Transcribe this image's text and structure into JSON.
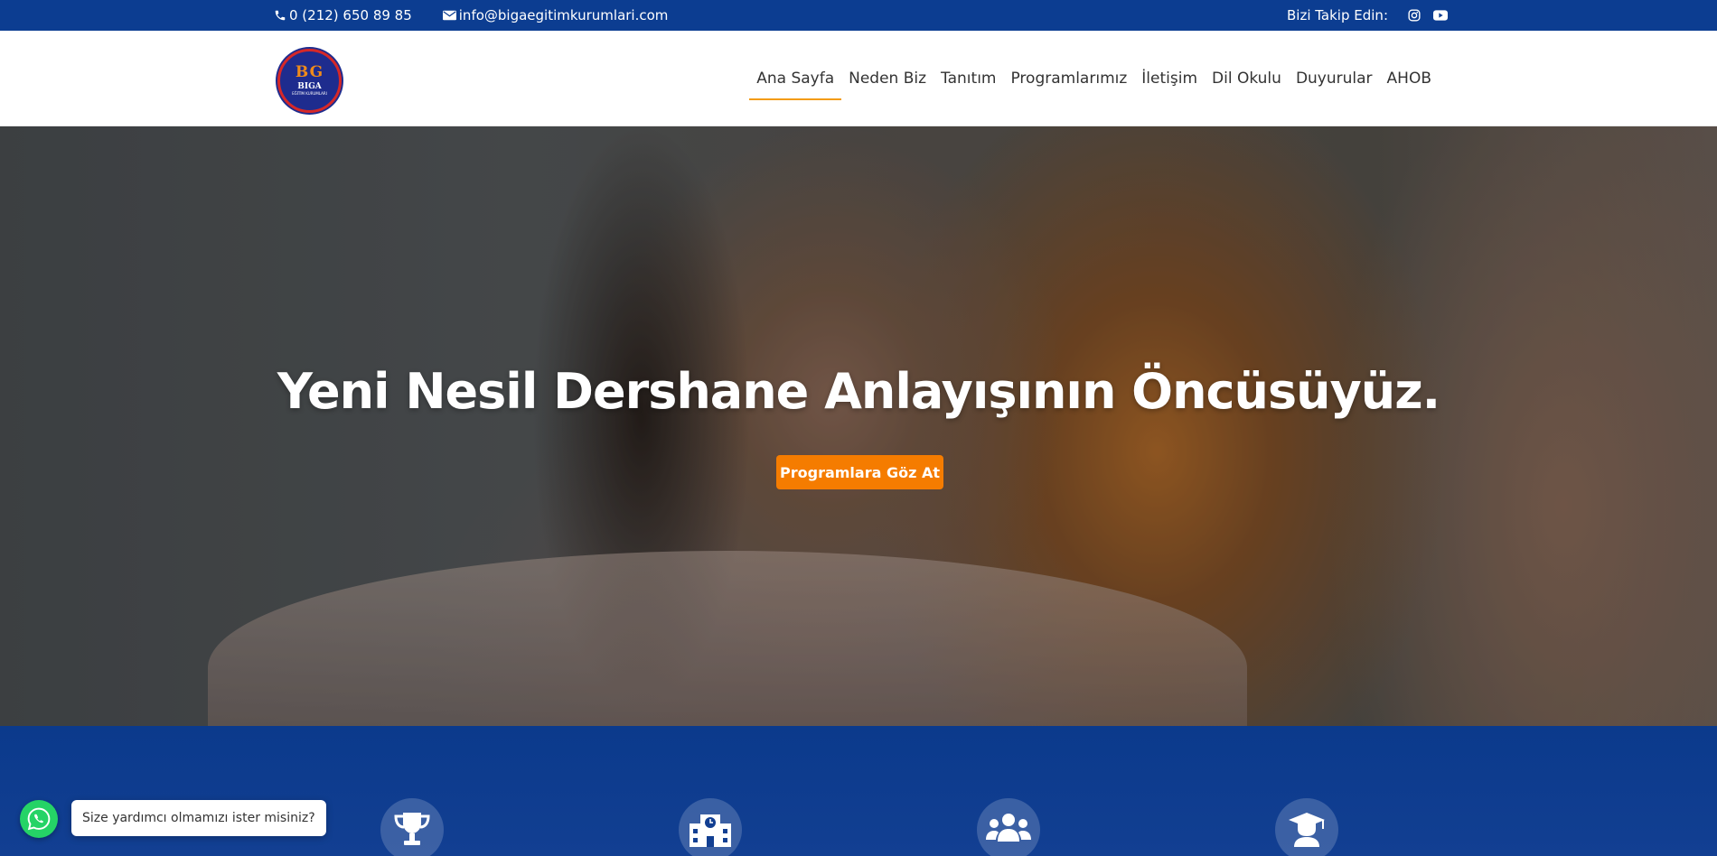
{
  "colors": {
    "topbar_bg": "#0c3d91",
    "accent_orange": "#f57c00",
    "nav_underline": "#f39c12",
    "features_bg": "#0b3a8c",
    "whatsapp_green": "#25d366"
  },
  "topbar": {
    "phone": "0 (212) 650 89 85",
    "email": "info@bigaegitimkurumlari.com",
    "follow_label": "Bizi Takip Edin:",
    "social_icons": [
      "instagram-icon",
      "youtube-icon"
    ]
  },
  "header": {
    "logo": {
      "mono": "BG",
      "name": "BIGA",
      "sub": "EĞİTİM KURUMLARI"
    },
    "nav": [
      {
        "label": "Ana Sayfa",
        "active": true
      },
      {
        "label": "Neden Biz"
      },
      {
        "label": "Tanıtım"
      },
      {
        "label": "Programlarımız"
      },
      {
        "label": "İletişim"
      },
      {
        "label": "Dil Okulu"
      },
      {
        "label": "Duyurular"
      },
      {
        "label": "AHOB"
      }
    ]
  },
  "hero": {
    "headline": "Yeni Nesil Dershane Anlayışının Öncüsüyüz.",
    "cta_label": "Programlara Göz At"
  },
  "features": {
    "icons": [
      "trophy-icon",
      "school-building-icon",
      "users-group-icon",
      "graduate-icon"
    ]
  },
  "whatsapp": {
    "message": "Size yardımcı olmamızı ister misiniz?"
  }
}
